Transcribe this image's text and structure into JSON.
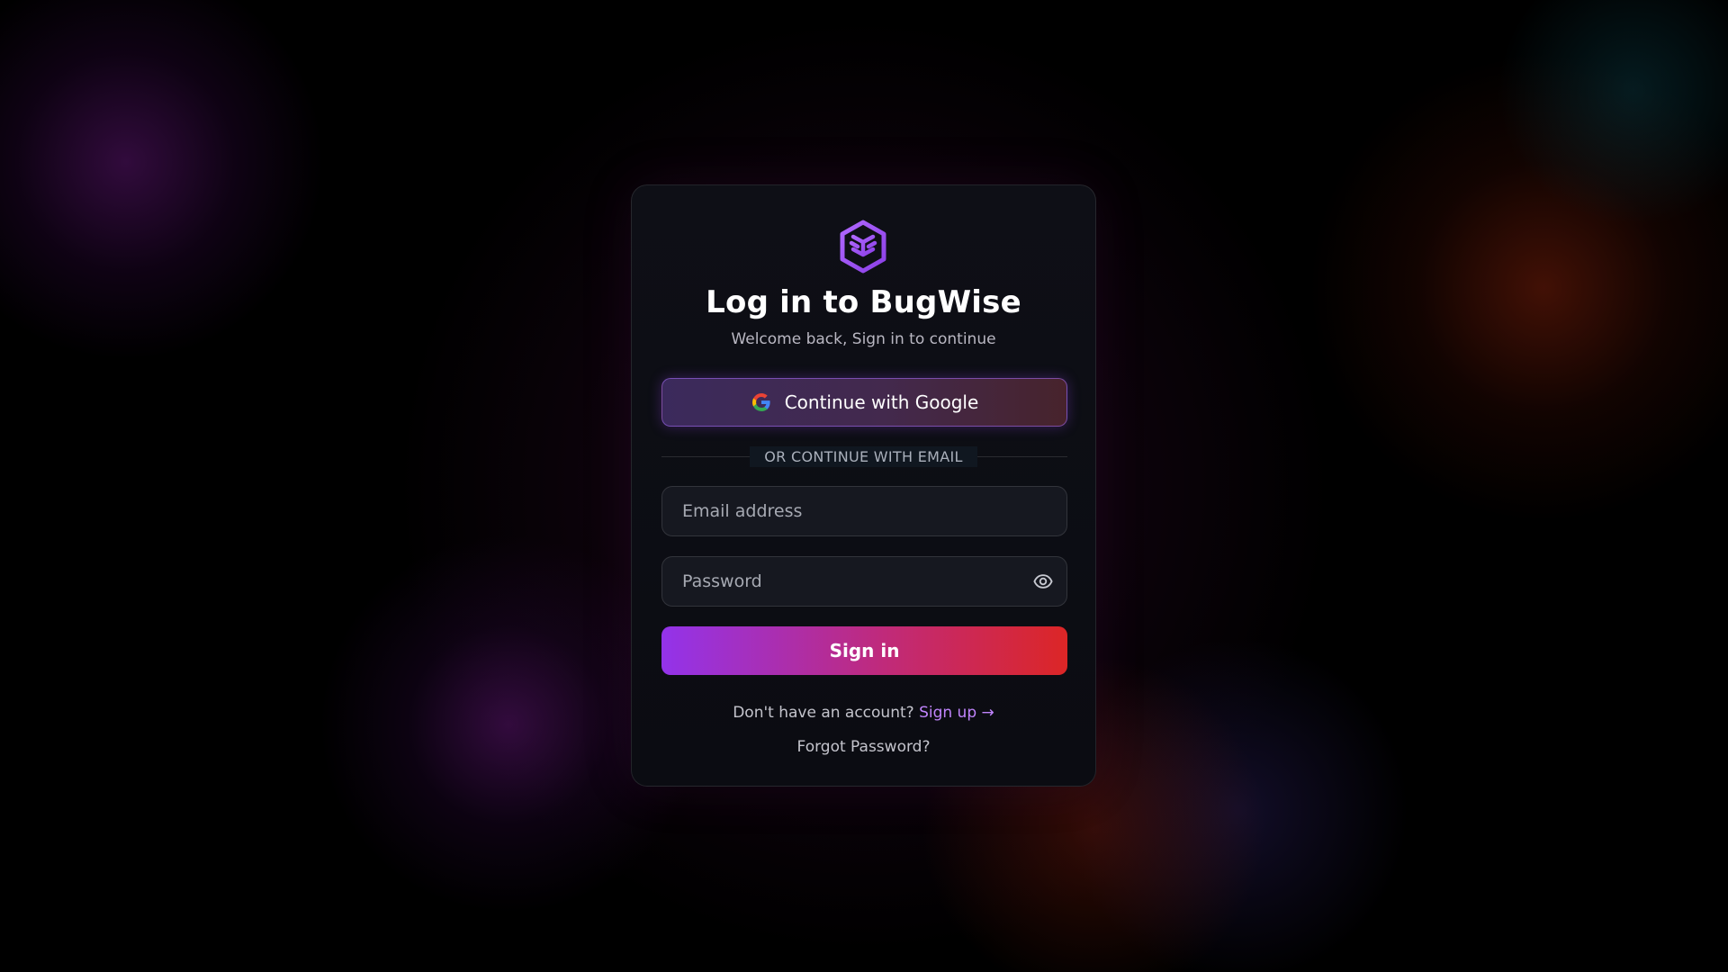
{
  "login": {
    "title": "Log in to BugWise",
    "subtitle": "Welcome back, Sign in to continue",
    "google_button": {
      "label": "Continue with Google",
      "icon": "google-icon"
    },
    "divider_text": "OR CONTINUE WITH EMAIL",
    "email_input": {
      "placeholder": "Email address",
      "value": ""
    },
    "password_input": {
      "placeholder": "Password",
      "value": "",
      "toggle_icon": "eye-icon"
    },
    "signin_button": "Sign in",
    "signup_prompt": "Don't have an account?",
    "signup_link": "Sign up →",
    "forgot_password": "Forgot Password?"
  },
  "logo": {
    "icon": "bugwise-logo"
  },
  "colors": {
    "accent_purple": "#9333ea",
    "accent_red": "#dc2626",
    "link_purple": "#c084fc",
    "card_background": "#0e0f16"
  }
}
